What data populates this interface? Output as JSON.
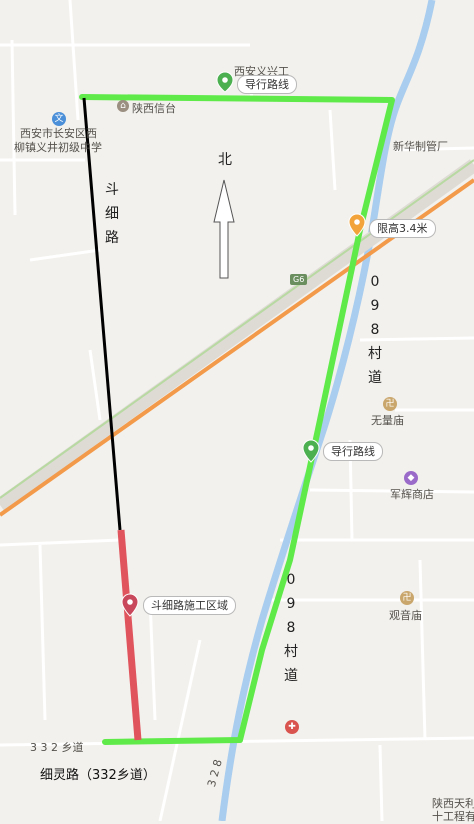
{
  "map": {
    "title_labels": {
      "village_north": "西安义兴工",
      "shaanxi_xintai": "陕西信台",
      "school_line1": "西安市长安区西",
      "school_line2": "柳镇义井初级中学",
      "factory": "新华制管厂",
      "highway": "G6",
      "temple1": "无量庙",
      "shop": "军辉商店",
      "temple2": "观音庙",
      "township_road": "3 3 2 乡道",
      "bottom_right_line1": "陕西天利",
      "bottom_right_line2": "十工程有",
      "road_bottom_number": "3 2 8"
    },
    "north_arrow_label": "北",
    "dou_xi_road_chars": [
      "斗",
      "细",
      "路"
    ],
    "village_road_chars_upper": [
      "0",
      "9",
      "8",
      "村",
      "道"
    ],
    "village_road_chars_lower": [
      "0",
      "9",
      "8",
      "村",
      "道"
    ],
    "road_caption": "细灵路（332乡道）",
    "markers": {
      "guide_route_top": "导行路线",
      "height_limit": "限高3.4米",
      "guide_route_mid": "导行路线",
      "construction_zone": "斗细路施工区域"
    },
    "colors": {
      "guide_route": "#5fea4a",
      "construction": "#e0555d",
      "dou_xi_road": "#000000",
      "highway_orange": "#f29a4a",
      "river": "#a9cdee",
      "pin_green": "#4caf50",
      "pin_orange": "#f2a33a",
      "pin_red": "#c9485b"
    }
  }
}
